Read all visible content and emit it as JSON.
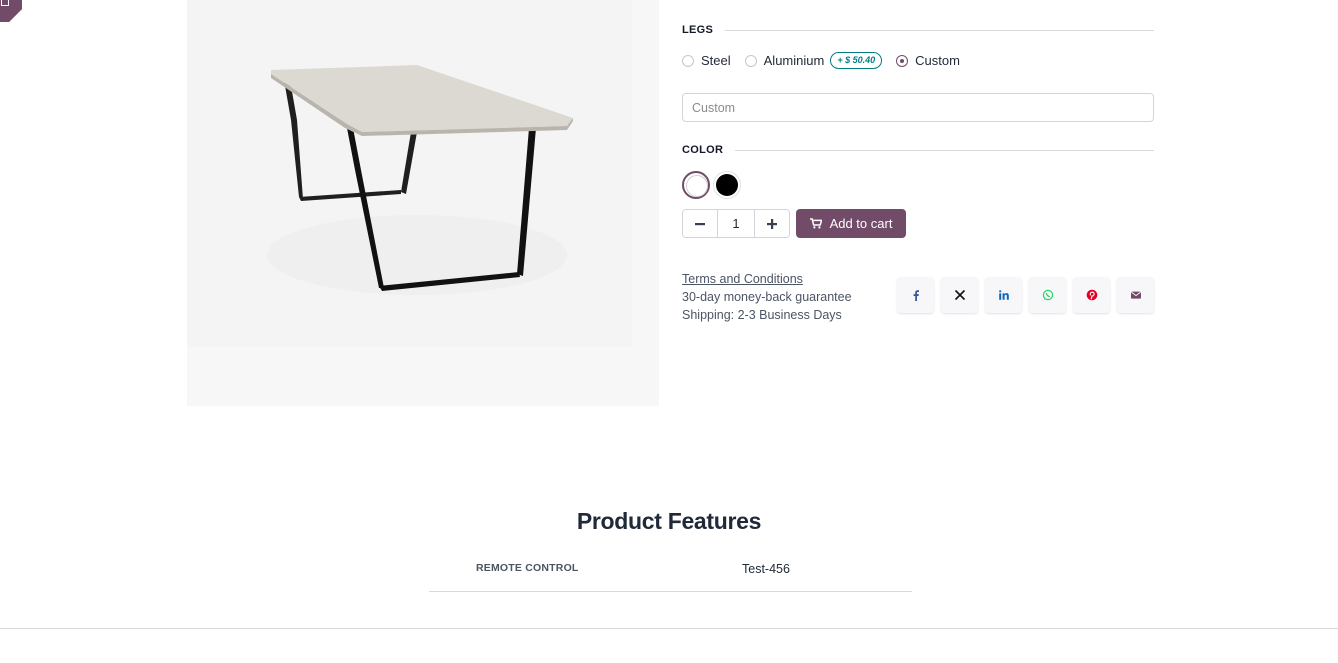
{
  "product": {
    "image_alt": "Table",
    "legs": {
      "heading": "LEGS",
      "options": [
        {
          "label": "Steel",
          "checked": false,
          "price_extra": ""
        },
        {
          "label": "Aluminium",
          "checked": false,
          "price_extra": "+ $ 50.40"
        },
        {
          "label": "Custom",
          "checked": true,
          "price_extra": ""
        }
      ],
      "custom_placeholder": "Custom"
    },
    "color": {
      "heading": "COLOR",
      "swatches": [
        {
          "name": "White",
          "hex": "#ffffff",
          "selected": true
        },
        {
          "name": "Black",
          "hex": "#000000",
          "selected": false
        }
      ]
    },
    "quantity": "1",
    "add_to_cart_label": "Add to cart",
    "terms_label": "Terms and Conditions",
    "guarantee": "30-day money-back guarantee",
    "shipping": "Shipping: 2-3 Business Days",
    "share": [
      {
        "icon": "facebook-icon",
        "color": "#3b5998"
      },
      {
        "icon": "x-twitter-icon",
        "color": "#111111"
      },
      {
        "icon": "linkedin-icon",
        "color": "#0a66c2"
      },
      {
        "icon": "whatsapp-icon",
        "color": "#25d366"
      },
      {
        "icon": "pinterest-icon",
        "color": "#e60023"
      },
      {
        "icon": "email-icon",
        "color": "#714b67"
      }
    ]
  },
  "features": {
    "title": "Product Features",
    "rows": [
      {
        "name": "REMOTE CONTROL",
        "value": "Test-456"
      }
    ]
  },
  "theme": {
    "primary": "#714b67",
    "secondary": "#017e84"
  }
}
